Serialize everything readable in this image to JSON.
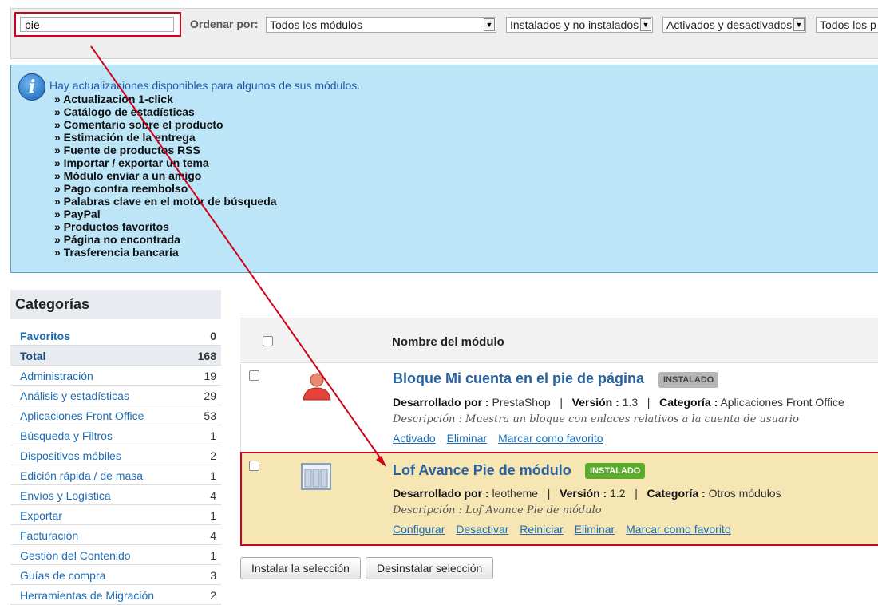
{
  "filters": {
    "search_value": "pie",
    "sort_label": "Ordenar por:",
    "selects": [
      "Todos los módulos",
      "Instalados y no instalados",
      "Activados y desactivados",
      "Todos los p"
    ]
  },
  "info": {
    "message": "Hay actualizaciones disponibles para algunos de sus módulos.",
    "modules": [
      "» Actualización 1-click",
      "» Catálogo de estadísticas",
      "» Comentario sobre el producto",
      "» Estimación de la entrega",
      "» Fuente de productos RSS",
      "» Importar / exportar un tema",
      "» Módulo enviar a un amigo",
      "» Pago contra reembolso",
      "» Palabras clave en el motor de búsqueda",
      "» PayPal",
      "» Productos favoritos",
      "» Página no encontrada",
      "» Trasferencia bancaria"
    ]
  },
  "sidebar": {
    "title": "Categorías",
    "items": [
      {
        "name": "Favoritos",
        "count": "0"
      },
      {
        "name": "Total",
        "count": "168"
      },
      {
        "name": "Administración",
        "count": "19"
      },
      {
        "name": "Análisis y estadísticas",
        "count": "29"
      },
      {
        "name": "Aplicaciones Front Office",
        "count": "53"
      },
      {
        "name": "Búsqueda y Filtros",
        "count": "1"
      },
      {
        "name": "Dispositivos móbiles",
        "count": "2"
      },
      {
        "name": "Edición rápida / de masa",
        "count": "1"
      },
      {
        "name": "Envíos y Logística",
        "count": "4"
      },
      {
        "name": "Exportar",
        "count": "1"
      },
      {
        "name": "Facturación",
        "count": "4"
      },
      {
        "name": "Gestión del Contenido",
        "count": "1"
      },
      {
        "name": "Guías de compra",
        "count": "3"
      },
      {
        "name": "Herramientas de Migración",
        "count": "2"
      }
    ]
  },
  "table": {
    "header": "Nombre del módulo",
    "modules": [
      {
        "title": "Bloque Mi cuenta en el pie de página",
        "badge": "INSTALADO",
        "dev_label": "Desarrollado por :",
        "dev": "PrestaShop",
        "ver_label": "Versión :",
        "ver": "1.3",
        "cat_label": "Categoría :",
        "cat": "Aplicaciones Front Office",
        "desc": "Descripción : Muestra un bloque con enlaces relativos a la cuenta de usuario",
        "links": [
          "Activado",
          "Eliminar",
          "Marcar como favorito"
        ]
      },
      {
        "title": "Lof Avance Pie de módulo",
        "badge": "INSTALADO",
        "dev_label": "Desarrollado por :",
        "dev": "leotheme",
        "ver_label": "Versión :",
        "ver": "1.2",
        "cat_label": "Categoría :",
        "cat": "Otros módulos",
        "desc": "Descripción : Lof Avance Pie de módulo",
        "links": [
          "Configurar",
          "Desactivar",
          "Reiniciar",
          "Eliminar",
          "Marcar como favorito"
        ]
      }
    ]
  },
  "actions": {
    "install": "Instalar la selección",
    "uninstall": "Desinstalar selección"
  },
  "colors": {
    "highlight_red": "#d0021b",
    "badge_grey": "#b5b5b5",
    "badge_green": "#5cac2b",
    "info_bg": "#bde5f8"
  }
}
